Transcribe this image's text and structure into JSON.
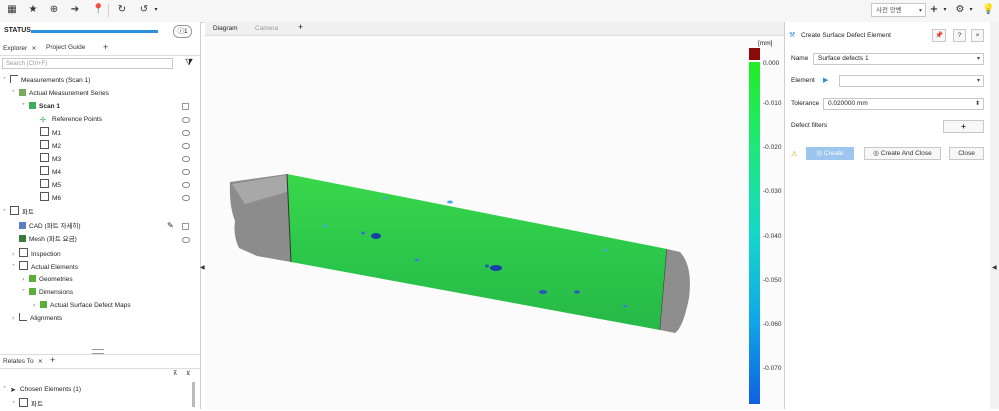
{
  "toolbar": {
    "icons": [
      "layout-icon",
      "star-icon",
      "reference-icon",
      "arrow-icon",
      "pin-icon",
      "refresh-icon",
      "reload-icon"
    ],
    "language_select": "사전 앙벤",
    "add_icon": "+",
    "right_icons": [
      "settings-icon",
      "light-icon"
    ]
  },
  "status": {
    "label": "STATUS",
    "badge": "1"
  },
  "left_tabs": {
    "explorer": "Explorer",
    "project_guide": "Project Guide",
    "close_glyph": "×",
    "add_glyph": "+"
  },
  "search": {
    "placeholder": "Search (Ctrl+F)"
  },
  "tree": {
    "measurements": "Measurements (Scan 1)",
    "series": "Actual Measurement Series",
    "scan1": "Scan 1",
    "reference_points": "Reference Points",
    "m1": "M1",
    "m2": "M2",
    "m3": "M3",
    "m4": "M4",
    "m5": "M5",
    "m6": "M6",
    "part": "파트",
    "cad": "CAD (파트 자세히)",
    "mesh": "Mesh (파트 요금)",
    "inspection": "Inspection",
    "actual_elements": "Actual Elements",
    "geometries": "Geometries",
    "dimensions": "Dimensions",
    "surface_defect_maps": "Actual Surface Defect Maps",
    "alignments": "Alignments"
  },
  "relates": {
    "label": "Relates To",
    "close_glyph": "×",
    "add_glyph": "+",
    "chosen": "Chosen Elements (1)",
    "part_child": "파트"
  },
  "center_tabs": {
    "diagram": "Diagram",
    "camera": "Camera",
    "add": "+"
  },
  "colorbar": {
    "unit": "[mm]",
    "ticks": [
      "0.000",
      "-0.010",
      "-0.020",
      "-0.030",
      "-0.040",
      "-0.050",
      "-0.060",
      "-0.070"
    ]
  },
  "dialog": {
    "title": "Create Surface Defect Element",
    "name_label": "Name",
    "name_value": "Surface defects 1",
    "element_label": "Element",
    "element_value": "",
    "tolerance_label": "Tolerance",
    "tolerance_value": "0.020000 mm",
    "defect_filters_label": "Defect filters",
    "add_glyph": "+",
    "create": "Create",
    "create_close": "Create And Close",
    "close": "Close",
    "help_glyph": "?",
    "close_glyph": "×"
  },
  "colors": {
    "accent": "#2d8fe0",
    "surface_green": "#22cc44",
    "defect_blue": "#1a3fa8"
  }
}
